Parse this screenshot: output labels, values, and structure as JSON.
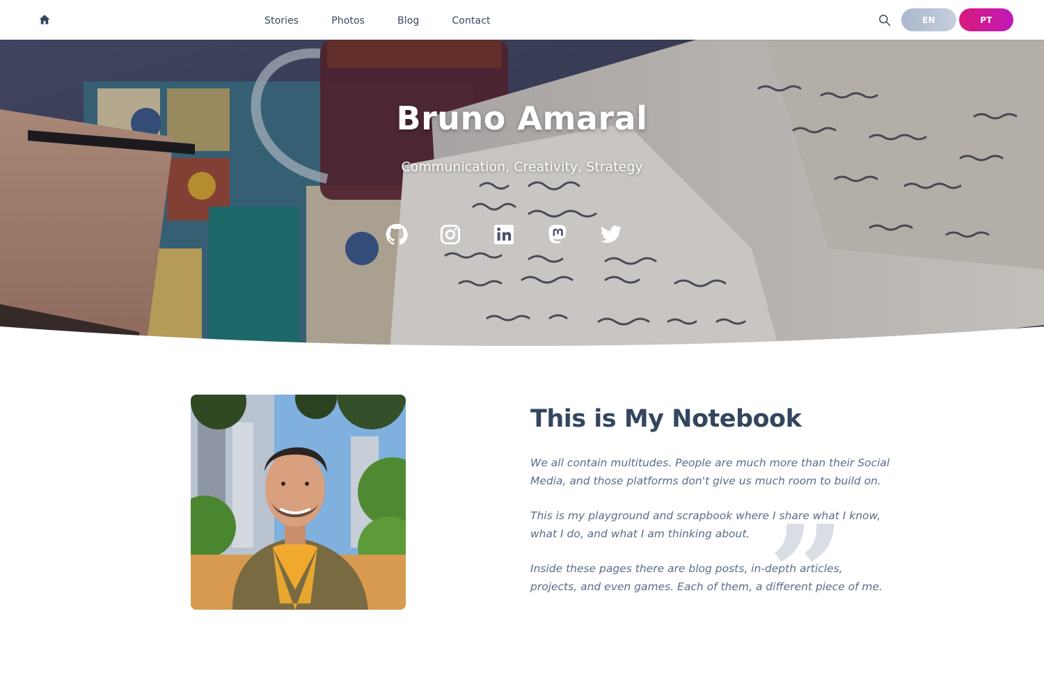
{
  "nav": {
    "home_icon": "home-icon",
    "items": [
      {
        "label": "Stories"
      },
      {
        "label": "Photos"
      },
      {
        "label": "Blog"
      },
      {
        "label": "Contact"
      }
    ],
    "search_icon": "search-icon",
    "languages": [
      {
        "label": "EN",
        "active": false
      },
      {
        "label": "PT",
        "active": true
      }
    ]
  },
  "hero": {
    "title": "Bruno Amaral",
    "subtitle": "Communication, Creativity, Strategy",
    "socials": [
      {
        "icon": "github-icon"
      },
      {
        "icon": "instagram-icon"
      },
      {
        "icon": "linkedin-icon"
      },
      {
        "icon": "mastodon-icon"
      },
      {
        "icon": "twitter-icon"
      }
    ]
  },
  "about": {
    "heading": "This is My Notebook",
    "paragraphs": [
      "We all contain multitudes. People are much more than their Social Media, and those platforms don't give us much room to build on.",
      "This is my playground and scrapbook where I share what I know, what I do, and what I am thinking about.",
      "Inside these pages there are blog posts, in-depth articles, projects, and even games. Each of them, a different piece of me."
    ],
    "quote_glyph": "”"
  },
  "colors": {
    "nav_text": "#34465f",
    "heading": "#34465f",
    "paragraph": "#5a6c8a",
    "lang_active": "#d81b7d",
    "lang_inactive": "#aab7cc"
  }
}
